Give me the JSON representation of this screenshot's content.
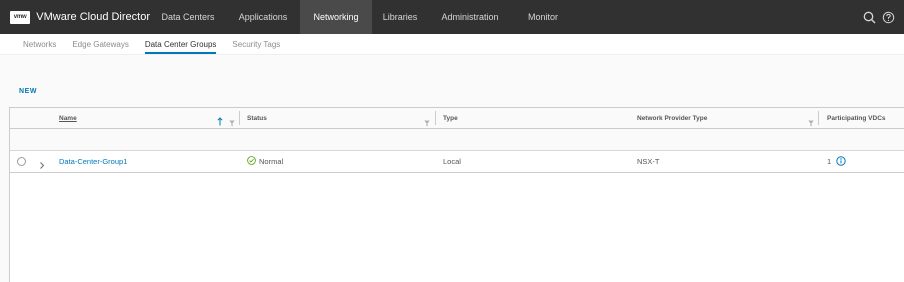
{
  "app": {
    "logo_text": "vmw",
    "title": "VMware Cloud Director",
    "nav": [
      {
        "label": "Data Centers",
        "active": false
      },
      {
        "label": "Applications",
        "active": false
      },
      {
        "label": "Networking",
        "active": true
      },
      {
        "label": "Libraries",
        "active": false
      },
      {
        "label": "Administration",
        "active": false
      },
      {
        "label": "Monitor",
        "active": false
      }
    ],
    "right_icons": [
      "search-icon",
      "help-icon"
    ]
  },
  "subnav": {
    "tabs": [
      {
        "label": "Networks",
        "active": false
      },
      {
        "label": "Edge Gateways",
        "active": false
      },
      {
        "label": "Data Center Groups",
        "active": true
      },
      {
        "label": "Security Tags",
        "active": false
      }
    ]
  },
  "toolbar": {
    "new_label": "NEW"
  },
  "grid": {
    "columns": [
      {
        "label": "Name",
        "sorted": "ascending",
        "filterable": true
      },
      {
        "label": "Status",
        "filterable": true
      },
      {
        "label": "Type",
        "filterable": false
      },
      {
        "label": "Network Provider Type",
        "filterable": true
      },
      {
        "label": "Participating VDCs",
        "filterable": false
      }
    ],
    "rows": [
      {
        "name": "Data-Center-Group1",
        "status": "Normal",
        "status_icon": "check-circle-icon",
        "type": "Local",
        "provider": "NSX-T",
        "vdcs": "1"
      }
    ]
  },
  "colors": {
    "nav_bg": "#313131",
    "nav_active_bg": "#4a4a4a",
    "accent": "#0079b8",
    "success": "#62a420"
  }
}
